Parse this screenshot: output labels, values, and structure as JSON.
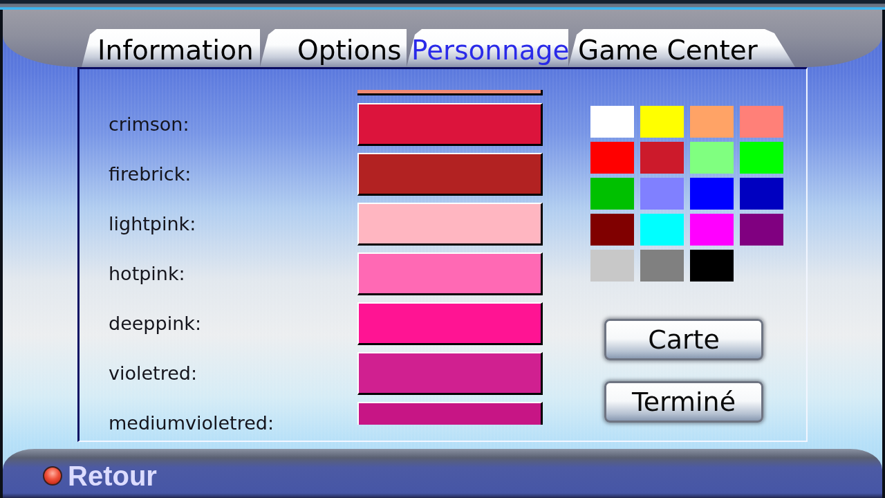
{
  "tabs": [
    {
      "label": "Information",
      "selected": false
    },
    {
      "label": "Options",
      "selected": false
    },
    {
      "label": "Personnage",
      "selected": true
    },
    {
      "label": "Game Center",
      "selected": false
    }
  ],
  "color_list": {
    "rows": [
      {
        "color": "#f08a74"
      },
      {
        "label": "crimson:",
        "color": "#dc143c"
      },
      {
        "label": "firebrick:",
        "color": "#b22222"
      },
      {
        "label": "lightpink:",
        "color": "#ffb6c1"
      },
      {
        "label": "hotpink:",
        "color": "#ff69b4"
      },
      {
        "label": "deeppink:",
        "color": "#ff1493"
      },
      {
        "label": "violetred:",
        "color": "#d02090"
      },
      {
        "label": "mediumvioletred:",
        "color": "#c71585"
      }
    ]
  },
  "palette": {
    "swatches": [
      {
        "color": "#ffffff"
      },
      {
        "color": "#ffff00"
      },
      {
        "color": "#ffa366"
      },
      {
        "color": "#ff8078"
      },
      {
        "color": "#ff0000"
      },
      {
        "color": "#cc1a2b"
      },
      {
        "color": "#80ff80"
      },
      {
        "color": "#00ff00"
      },
      {
        "color": "#00c000"
      },
      {
        "color": "#8080ff"
      },
      {
        "color": "#0000ff"
      },
      {
        "color": "#0000c0"
      },
      {
        "color": "#800000"
      },
      {
        "color": "#00ffff"
      },
      {
        "color": "#ff00ff"
      },
      {
        "color": "#800080"
      },
      {
        "color": "#c8c8c8"
      },
      {
        "color": "#808080"
      },
      {
        "color": "#000000"
      }
    ]
  },
  "buttons": [
    {
      "label": "Carte"
    },
    {
      "label": "Terminé"
    }
  ],
  "footer": {
    "back_label": "Retour"
  }
}
